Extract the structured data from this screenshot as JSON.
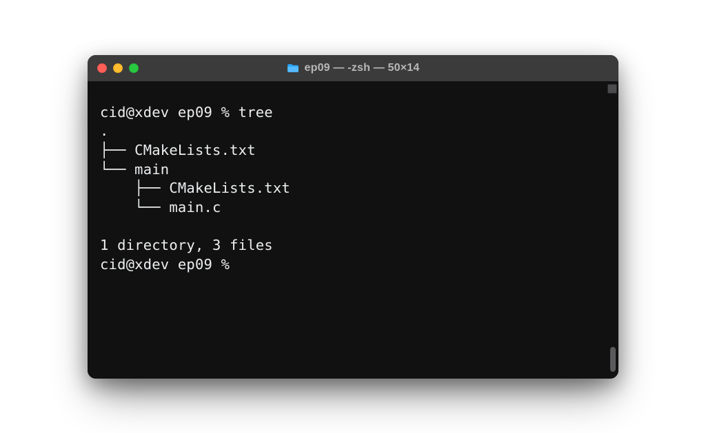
{
  "window": {
    "title": "ep09 — -zsh — 50×14"
  },
  "prompt": {
    "user": "cid",
    "host": "xdev",
    "cwd": "ep09",
    "symbol": "%"
  },
  "command": "tree",
  "tree": {
    "root": ".",
    "entries": [
      {
        "prefix": "├── ",
        "name": "CMakeLists.txt"
      },
      {
        "prefix": "└── ",
        "name": "main"
      },
      {
        "prefix": "    ├── ",
        "name": "CMakeLists.txt"
      },
      {
        "prefix": "    └── ",
        "name": "main.c"
      }
    ],
    "summary": "1 directory, 3 files"
  },
  "lines": {
    "l1": "cid@xdev ep09 % tree",
    "l2": ".",
    "l3": "├── CMakeLists.txt",
    "l4": "└── main",
    "l5": "    ├── CMakeLists.txt",
    "l6": "    └── main.c",
    "l7": "",
    "l8": "1 directory, 3 files",
    "l9": "cid@xdev ep09 % "
  }
}
